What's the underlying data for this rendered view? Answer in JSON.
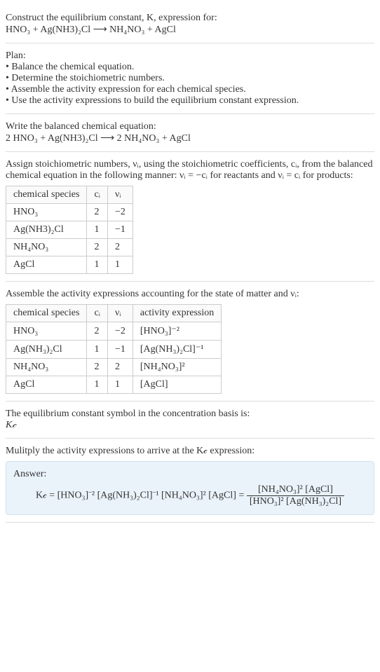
{
  "header": {
    "title_line1": "Construct the equilibrium constant, K, expression for:",
    "equation": "HNO₃ + Ag(NH3)₂Cl ⟶ NH₄NO₃ + AgCl"
  },
  "plan": {
    "heading": "Plan:",
    "items": [
      "• Balance the chemical equation.",
      "• Determine the stoichiometric numbers.",
      "• Assemble the activity expression for each chemical species.",
      "• Use the activity expressions to build the equilibrium constant expression."
    ]
  },
  "balanced": {
    "heading": "Write the balanced chemical equation:",
    "equation": "2 HNO₃ + Ag(NH3)₂Cl ⟶ 2 NH₄NO₃ + AgCl"
  },
  "stoich": {
    "heading": "Assign stoichiometric numbers, νᵢ, using the stoichiometric coefficients, cᵢ, from the balanced chemical equation in the following manner: νᵢ = −cᵢ for reactants and νᵢ = cᵢ for products:",
    "headers": [
      "chemical species",
      "cᵢ",
      "νᵢ"
    ],
    "rows": [
      [
        "HNO₃",
        "2",
        "−2"
      ],
      [
        "Ag(NH3)₂Cl",
        "1",
        "−1"
      ],
      [
        "NH₄NO₃",
        "2",
        "2"
      ],
      [
        "AgCl",
        "1",
        "1"
      ]
    ]
  },
  "activity": {
    "heading": "Assemble the activity expressions accounting for the state of matter and νᵢ:",
    "headers": [
      "chemical species",
      "cᵢ",
      "νᵢ",
      "activity expression"
    ],
    "rows": [
      [
        "HNO₃",
        "2",
        "−2",
        "[HNO₃]⁻²"
      ],
      [
        "Ag(NH₃)₂Cl",
        "1",
        "−1",
        "[Ag(NH₃)₂Cl]⁻¹"
      ],
      [
        "NH₄NO₃",
        "2",
        "2",
        "[NH₄NO₃]²"
      ],
      [
        "AgCl",
        "1",
        "1",
        "[AgCl]"
      ]
    ]
  },
  "symbol": {
    "heading": "The equilibrium constant symbol in the concentration basis is:",
    "value": "K𝒸"
  },
  "multiply": {
    "heading": "Mulitply the activity expressions to arrive at the K𝒸 expression:"
  },
  "answer": {
    "label": "Answer:",
    "lhs": "K𝒸 = [HNO₃]⁻² [Ag(NH₃)₂Cl]⁻¹ [NH₄NO₃]² [AgCl] = ",
    "frac_num": "[NH₄NO₃]² [AgCl]",
    "frac_den": "[HNO₃]² [Ag(NH₃)₂Cl]"
  },
  "chart_data": {
    "type": "table",
    "tables": [
      {
        "title": "Stoichiometric numbers",
        "columns": [
          "chemical species",
          "c_i",
          "nu_i"
        ],
        "rows": [
          {
            "chemical species": "HNO3",
            "c_i": 2,
            "nu_i": -2
          },
          {
            "chemical species": "Ag(NH3)2Cl",
            "c_i": 1,
            "nu_i": -1
          },
          {
            "chemical species": "NH4NO3",
            "c_i": 2,
            "nu_i": 2
          },
          {
            "chemical species": "AgCl",
            "c_i": 1,
            "nu_i": 1
          }
        ]
      },
      {
        "title": "Activity expressions",
        "columns": [
          "chemical species",
          "c_i",
          "nu_i",
          "activity expression"
        ],
        "rows": [
          {
            "chemical species": "HNO3",
            "c_i": 2,
            "nu_i": -2,
            "activity expression": "[HNO3]^-2"
          },
          {
            "chemical species": "Ag(NH3)2Cl",
            "c_i": 1,
            "nu_i": -1,
            "activity expression": "[Ag(NH3)2Cl]^-1"
          },
          {
            "chemical species": "NH4NO3",
            "c_i": 2,
            "nu_i": 2,
            "activity expression": "[NH4NO3]^2"
          },
          {
            "chemical species": "AgCl",
            "c_i": 1,
            "nu_i": 1,
            "activity expression": "[AgCl]"
          }
        ]
      }
    ]
  }
}
